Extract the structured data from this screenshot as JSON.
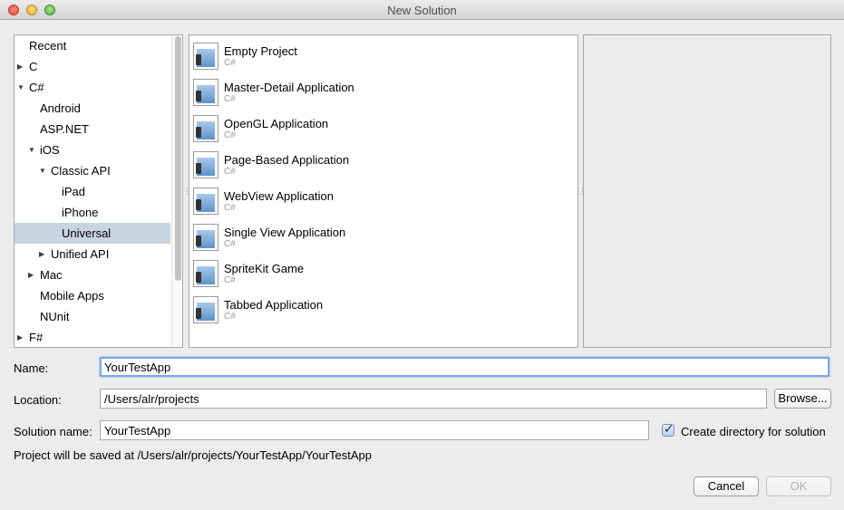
{
  "window": {
    "title": "New Solution"
  },
  "tree": {
    "items": [
      {
        "label": "Recent",
        "level": 0,
        "toggle": ""
      },
      {
        "label": "C",
        "level": 0,
        "toggle": "collapsed"
      },
      {
        "label": "C#",
        "level": 0,
        "toggle": "expanded"
      },
      {
        "label": "Android",
        "level": 1,
        "toggle": ""
      },
      {
        "label": "ASP.NET",
        "level": 1,
        "toggle": ""
      },
      {
        "label": "iOS",
        "level": 1,
        "toggle": "expanded"
      },
      {
        "label": "Classic API",
        "level": 2,
        "toggle": "expanded"
      },
      {
        "label": "iPad",
        "level": 3,
        "toggle": ""
      },
      {
        "label": "iPhone",
        "level": 3,
        "toggle": ""
      },
      {
        "label": "Universal",
        "level": 3,
        "toggle": "",
        "selected": true
      },
      {
        "label": "Unified API",
        "level": 2,
        "toggle": "collapsed"
      },
      {
        "label": "Mac",
        "level": 1,
        "toggle": "collapsed"
      },
      {
        "label": "Mobile Apps",
        "level": 1,
        "toggle": ""
      },
      {
        "label": "NUnit",
        "level": 1,
        "toggle": ""
      },
      {
        "label": "F#",
        "level": 0,
        "toggle": "collapsed"
      }
    ]
  },
  "templates": [
    {
      "name": "Empty Project",
      "lang": "C#"
    },
    {
      "name": "Master-Detail Application",
      "lang": "C#"
    },
    {
      "name": "OpenGL Application",
      "lang": "C#"
    },
    {
      "name": "Page-Based Application",
      "lang": "C#"
    },
    {
      "name": "WebView Application",
      "lang": "C#"
    },
    {
      "name": "Single View Application",
      "lang": "C#"
    },
    {
      "name": "SpriteKit Game",
      "lang": "C#"
    },
    {
      "name": "Tabbed Application",
      "lang": "C#"
    }
  ],
  "form": {
    "name_label": "Name:",
    "name_value": "YourTestApp",
    "location_label": "Location:",
    "location_value": "/Users/alr/projects",
    "browse_label": "Browse...",
    "solution_label": "Solution name:",
    "solution_value": "YourTestApp",
    "create_dir_label": "Create directory for solution",
    "create_dir_checked": true,
    "save_info": "Project will be saved at /Users/alr/projects/YourTestApp/YourTestApp"
  },
  "buttons": {
    "cancel": "Cancel",
    "ok": "OK"
  }
}
